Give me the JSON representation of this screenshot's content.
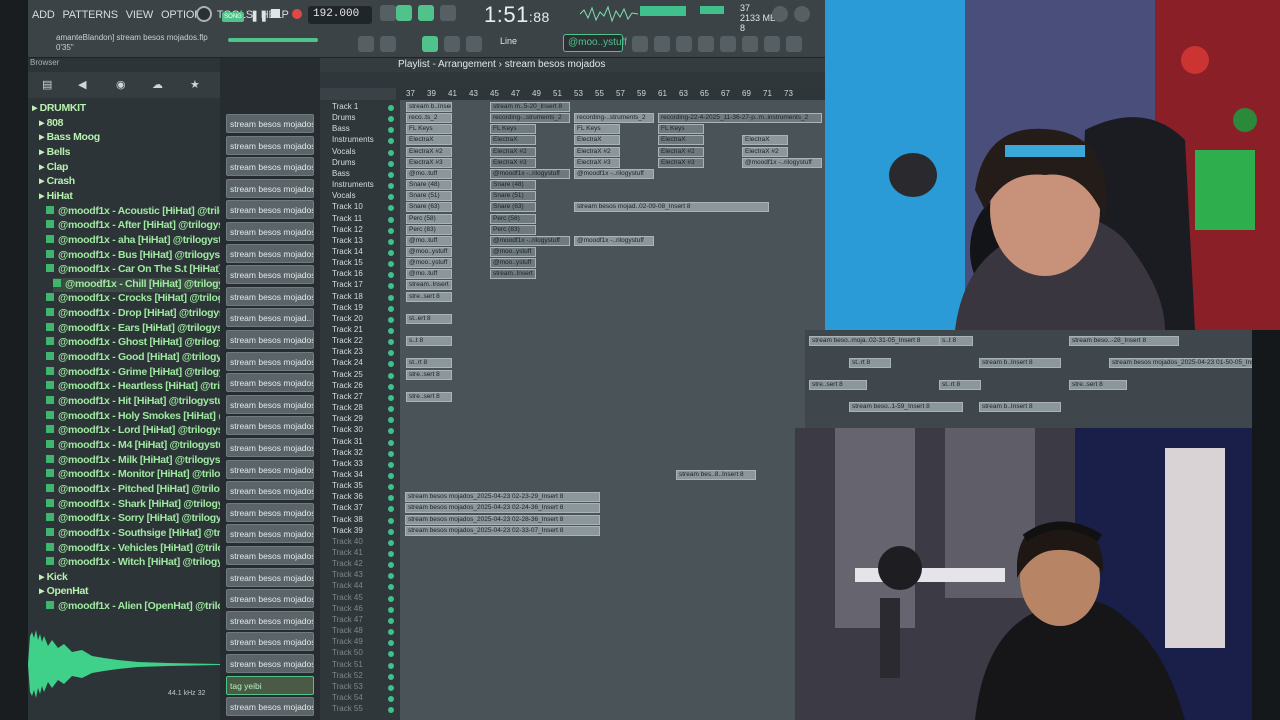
{
  "menu": [
    "ADD",
    "PATTERNS",
    "VIEW",
    "OPTIONS",
    "TOOLS",
    "HELP"
  ],
  "transport": {
    "song_label": "SONG",
    "tempo": "192.000",
    "time": "1:51",
    "time_frac": "88",
    "cpu_top": "37",
    "ram": "2133 MB",
    "ram_sub": "8"
  },
  "project": {
    "name": "amanteBlandon] stream besos mojados.flp",
    "len": "0'35\""
  },
  "toolbar": {
    "snap": "Line",
    "pattern": "@moo..ystuff"
  },
  "playlist": {
    "title": "Playlist - Arrangement",
    "pattern": "stream besos mojados",
    "ruler": [
      "37",
      "39",
      "41",
      "43",
      "45",
      "47",
      "49",
      "51",
      "53",
      "55",
      "57",
      "59",
      "61",
      "63",
      "65",
      "67",
      "69",
      "71",
      "73"
    ]
  },
  "browser": {
    "header": "Browser",
    "items": [
      {
        "label": "DRUMKIT",
        "folder": true,
        "indent": 0
      },
      {
        "label": "808",
        "folder": true,
        "indent": 1
      },
      {
        "label": "Bass Moog",
        "folder": true,
        "indent": 1
      },
      {
        "label": "Bells",
        "folder": true,
        "indent": 1
      },
      {
        "label": "Clap",
        "folder": true,
        "indent": 1
      },
      {
        "label": "Crash",
        "folder": true,
        "indent": 1
      },
      {
        "label": "HiHat",
        "folder": true,
        "indent": 1
      },
      {
        "label": "@moodf1x - Acoustic [HiHat] @trilogystuff",
        "indent": 2
      },
      {
        "label": "@moodf1x - After [HiHat] @trilogystuff",
        "indent": 2
      },
      {
        "label": "@moodf1x - aha [HiHat] @trilogystuff",
        "indent": 2
      },
      {
        "label": "@moodf1x - Bus [HiHat] @trilogystuff",
        "indent": 2
      },
      {
        "label": "@moodf1x - Car On The S.t [HiHat] @trilogystuff",
        "indent": 2
      },
      {
        "label": "@moodf1x - Chill [HiHat] @trilogystuff",
        "indent": 3,
        "selected": true
      },
      {
        "label": "@moodf1x - Crocks [HiHat] @trilogystuff",
        "indent": 2
      },
      {
        "label": "@moodf1x - Drop [HiHat] @trilogystuff",
        "indent": 2
      },
      {
        "label": "@moodf1x - Ears [HiHat] @trilogystuff",
        "indent": 2
      },
      {
        "label": "@moodf1x - Ghost [HiHat] @trilogystuff",
        "indent": 2
      },
      {
        "label": "@moodf1x - Good [HiHat] @trilogystuff",
        "indent": 2
      },
      {
        "label": "@moodf1x - Grime [HiHat] @trilogystuff",
        "indent": 2
      },
      {
        "label": "@moodf1x - Heartless [HiHat] @trilogystuff",
        "indent": 2
      },
      {
        "label": "@moodf1x - Hit [HiHat] @trilogystuff",
        "indent": 2
      },
      {
        "label": "@moodf1x - Holy Smokes [HiHat] @trilogystuff",
        "indent": 2
      },
      {
        "label": "@moodf1x - Lord [HiHat] @trilogystuff",
        "indent": 2
      },
      {
        "label": "@moodf1x - M4 [HiHat] @trilogystuff",
        "indent": 2
      },
      {
        "label": "@moodf1x - Milk [HiHat] @trilogystuff",
        "indent": 2
      },
      {
        "label": "@moodf1x - Monitor [HiHat] @trilogystuff",
        "indent": 2
      },
      {
        "label": "@moodf1x - Pitched [HiHat] @trilogystuff",
        "indent": 2
      },
      {
        "label": "@moodf1x - Shark [HiHat] @trilogystuff",
        "indent": 2
      },
      {
        "label": "@moodf1x - Sorry [HiHat] @trilogystuff",
        "indent": 2
      },
      {
        "label": "@moodf1x - Southsige [HiHat] @trilogystuff",
        "indent": 2
      },
      {
        "label": "@moodf1x - Vehicles [HiHat] @trilogystuff",
        "indent": 2
      },
      {
        "label": "@moodf1x - Witch [HiHat] @trilogystuff",
        "indent": 2
      },
      {
        "label": "Kick",
        "folder": true,
        "indent": 1
      },
      {
        "label": "OpenHat",
        "folder": true,
        "indent": 1
      },
      {
        "label": "@moodf1x - Alien [OpenHat] @trilogystuff",
        "indent": 2
      }
    ],
    "sample_info": "44.1 kHz 32"
  },
  "picker": {
    "items": [
      "stream besos mojados_2",
      "stream besos mojados_2",
      "stream besos mojados_2",
      "stream besos mojados_2",
      "stream besos mojados_2",
      "stream besos mojados_2",
      "stream besos mojados_2",
      "stream besos mojados_2",
      "stream besos mojados_2",
      "stream besos mojad..",
      "stream besos mojados_2",
      "stream besos mojados_2",
      "stream besos mojados_2",
      "stream besos mojados_2",
      "stream besos mojados_2",
      "stream besos mojados_2",
      "stream besos mojados_2",
      "stream besos mojados_2",
      "stream besos mojados_2",
      "stream besos mojados_2",
      "stream besos mojados_2",
      "stream besos mojados_2",
      "stream besos mojados_2",
      "stream besos mojados_2",
      "stream besos mojados_2",
      "stream besos mojados_2",
      "tag yeibi",
      "stream besos mojados"
    ]
  },
  "tracks": [
    {
      "name": "Track 1"
    },
    {
      "name": "Drums"
    },
    {
      "name": "Bass"
    },
    {
      "name": "Instruments"
    },
    {
      "name": "Vocals"
    },
    {
      "name": "Drums"
    },
    {
      "name": "Bass"
    },
    {
      "name": "Instruments"
    },
    {
      "name": "Vocals"
    },
    {
      "name": "Track 10"
    },
    {
      "name": "Track 11"
    },
    {
      "name": "Track 12"
    },
    {
      "name": "Track 13"
    },
    {
      "name": "Track 14"
    },
    {
      "name": "Track 15"
    },
    {
      "name": "Track 16"
    },
    {
      "name": "Track 17"
    },
    {
      "name": "Track 18"
    },
    {
      "name": "Track 19"
    },
    {
      "name": "Track 20"
    },
    {
      "name": "Track 21"
    },
    {
      "name": "Track 22"
    },
    {
      "name": "Track 23"
    },
    {
      "name": "Track 24"
    },
    {
      "name": "Track 25"
    },
    {
      "name": "Track 26"
    },
    {
      "name": "Track 27"
    },
    {
      "name": "Track 28"
    },
    {
      "name": "Track 29"
    },
    {
      "name": "Track 30"
    },
    {
      "name": "Track 31"
    },
    {
      "name": "Track 32"
    },
    {
      "name": "Track 33"
    },
    {
      "name": "Track 34"
    },
    {
      "name": "Track 35"
    },
    {
      "name": "Track 36"
    },
    {
      "name": "Track 37"
    },
    {
      "name": "Track 38"
    },
    {
      "name": "Track 39"
    },
    {
      "name": "Track 40"
    },
    {
      "name": "Track 41"
    },
    {
      "name": "Track 42"
    },
    {
      "name": "Track 43"
    },
    {
      "name": "Track 44"
    },
    {
      "name": "Track 45"
    },
    {
      "name": "Track 46"
    },
    {
      "name": "Track 47"
    },
    {
      "name": "Track 48"
    },
    {
      "name": "Track 49"
    },
    {
      "name": "Track 50"
    },
    {
      "name": "Track 51"
    },
    {
      "name": "Track 52"
    },
    {
      "name": "Track 53"
    },
    {
      "name": "Track 54"
    },
    {
      "name": "Track 55"
    }
  ],
  "clips": [
    {
      "row": 0,
      "label": "stream b..Insert 8"
    },
    {
      "row": 0,
      "label": "stream m..5-20_Insert 8"
    },
    {
      "row": 1,
      "label": "reco..ts_2"
    },
    {
      "row": 1,
      "label": "recording-..struments_2"
    },
    {
      "row": 1,
      "label": "recording-..struments_2"
    },
    {
      "row": 1,
      "label": "recording-22-4-2025_11-36-27-p..m..instruments_2"
    },
    {
      "row": 2,
      "label": "FL Keys"
    },
    {
      "row": 2,
      "label": "FL Keys"
    },
    {
      "row": 2,
      "label": "FL Keys"
    },
    {
      "row": 2,
      "label": "FL Keys"
    },
    {
      "row": 3,
      "label": "ElectraX"
    },
    {
      "row": 3,
      "label": "ElectraX"
    },
    {
      "row": 3,
      "label": "ElectraX"
    },
    {
      "row": 3,
      "label": "ElectraX"
    },
    {
      "row": 3,
      "label": "ElectraX"
    },
    {
      "row": 4,
      "label": "ElectraX #2"
    },
    {
      "row": 4,
      "label": "ElectraX #2"
    },
    {
      "row": 4,
      "label": "ElectraX #2"
    },
    {
      "row": 4,
      "label": "ElectraX #2"
    },
    {
      "row": 4,
      "label": "ElectraX #2"
    },
    {
      "row": 5,
      "label": "ElectraX #3"
    },
    {
      "row": 5,
      "label": "ElectraX #3"
    },
    {
      "row": 5,
      "label": "ElectraX #3"
    },
    {
      "row": 5,
      "label": "ElectraX #3"
    },
    {
      "row": 5,
      "label": "@moodf1x -..rilogystuff"
    },
    {
      "row": 6,
      "label": "@mo..tuff"
    },
    {
      "row": 6,
      "label": "@moodf1x -..rilogystuff"
    },
    {
      "row": 6,
      "label": "@moodf1x -..rilogystuff"
    },
    {
      "row": 7,
      "label": "Snare (48)"
    },
    {
      "row": 7,
      "label": "Snare (48)"
    },
    {
      "row": 8,
      "label": "Snare (51)"
    },
    {
      "row": 8,
      "label": "Snare (51)"
    },
    {
      "row": 9,
      "label": "Snare (63)"
    },
    {
      "row": 9,
      "label": "Snare (63)"
    },
    {
      "row": 9,
      "label": "stream besos mojad..02-09-08_Insert 8"
    },
    {
      "row": 10,
      "label": "Perc (58)"
    },
    {
      "row": 10,
      "label": "Perc (58)"
    },
    {
      "row": 11,
      "label": "Perc (83)"
    },
    {
      "row": 11,
      "label": "Perc (83)"
    },
    {
      "row": 12,
      "label": "@mo..tuff"
    },
    {
      "row": 12,
      "label": "@moodf1x -..rilogystuff"
    },
    {
      "row": 12,
      "label": "@moodf1x -..rilogystuff"
    },
    {
      "row": 13,
      "label": "@moo..ystuff"
    },
    {
      "row": 13,
      "label": "@moo..ystuff"
    },
    {
      "row": 14,
      "label": "@moo..ystuff"
    },
    {
      "row": 14,
      "label": "@moo..ystuff"
    },
    {
      "row": 15,
      "label": "@mo..tuff"
    },
    {
      "row": 15,
      "label": "stream..Insert 8"
    },
    {
      "row": 16,
      "label": "stream..Insert 8"
    },
    {
      "row": 17,
      "label": "stre..sert 8"
    },
    {
      "row": 19,
      "label": "st..ert 8"
    },
    {
      "row": 21,
      "label": "s..t 8"
    },
    {
      "row": 23,
      "label": "st..rt 8"
    },
    {
      "row": 24,
      "label": "stre..sert 8"
    },
    {
      "row": 26,
      "label": "stre..sert 8"
    },
    {
      "row": 33,
      "label": "stream bes..8..Insert 8"
    },
    {
      "row": 35,
      "label": "stream besos mojados_2025-04-23 02-23-29_Insert 8"
    },
    {
      "row": 36,
      "label": "stream besos mojados_2025-04-23 02-24-36_Insert 8"
    },
    {
      "row": 37,
      "label": "stream besos mojados_2025-04-23 02-28-36_Insert 8"
    },
    {
      "row": 38,
      "label": "stream besos mojados_2025-04-23 02-33-07_Insert 8"
    }
  ],
  "overlay_clips": [
    {
      "label": "stream beso..moja..02-31-05_Insert 8"
    },
    {
      "label": "s..t 8"
    },
    {
      "label": "stream beso..-28_Insert 8"
    },
    {
      "label": "st..rt 8"
    },
    {
      "label": "stream b..Insert 8"
    },
    {
      "label": "stream besos mojados_2025-04-23 01-50-05_Insert 8"
    },
    {
      "label": "stre..sert 8"
    },
    {
      "label": "st..rt 8"
    },
    {
      "label": "stre..sert 8"
    },
    {
      "label": "stream beso..1-59_Insert 8"
    },
    {
      "label": "stream b..Insert 8"
    }
  ],
  "colors": {
    "accent": "#4fc38a",
    "clip": "#8c979c",
    "bg": "#2b3236",
    "record": "#e04848"
  }
}
